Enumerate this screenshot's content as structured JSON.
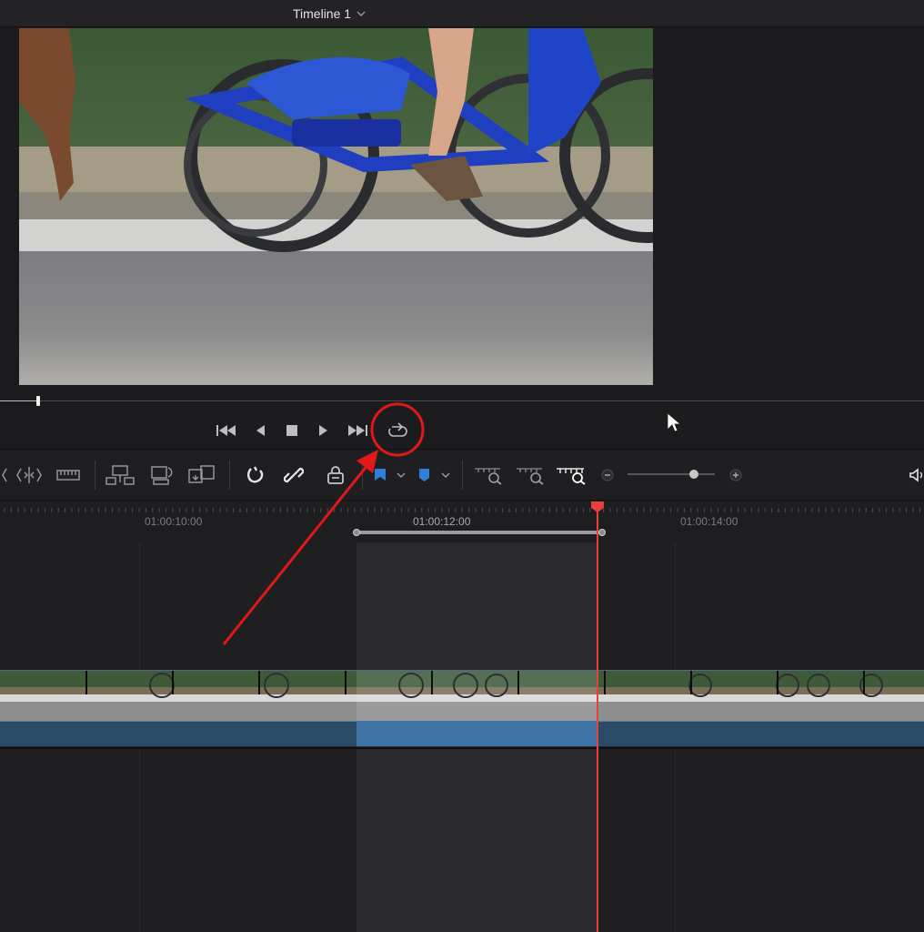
{
  "header": {
    "timeline_title": "Timeline 1"
  },
  "ruler": {
    "tc_1": "01:00:10:00",
    "tc_2": "01:00:12:00",
    "tc_3": "01:00:14:00"
  },
  "colors": {
    "accent_red": "#e8413b",
    "clip_blue": "#3f73a3",
    "marker_blue": "#2f7fd6"
  },
  "icons": {
    "transport": [
      "skip-to-start-icon",
      "reverse-play-icon",
      "stop-icon",
      "play-icon",
      "skip-to-end-icon",
      "loop-icon"
    ],
    "toolbar": [
      "dynamic-trim-icon",
      "trim-edit-icon",
      "razor-blade-icon",
      "insert-clip-icon",
      "overwrite-clip-icon",
      "replace-clip-icon",
      "snapping-icon",
      "linked-selection-icon",
      "position-lock-icon",
      "flag-icon",
      "marker-icon",
      "zoom-full-icon",
      "zoom-detail-icon",
      "zoom-custom-icon",
      "zoom-out-icon",
      "zoom-in-icon",
      "audio-volume-icon"
    ]
  }
}
